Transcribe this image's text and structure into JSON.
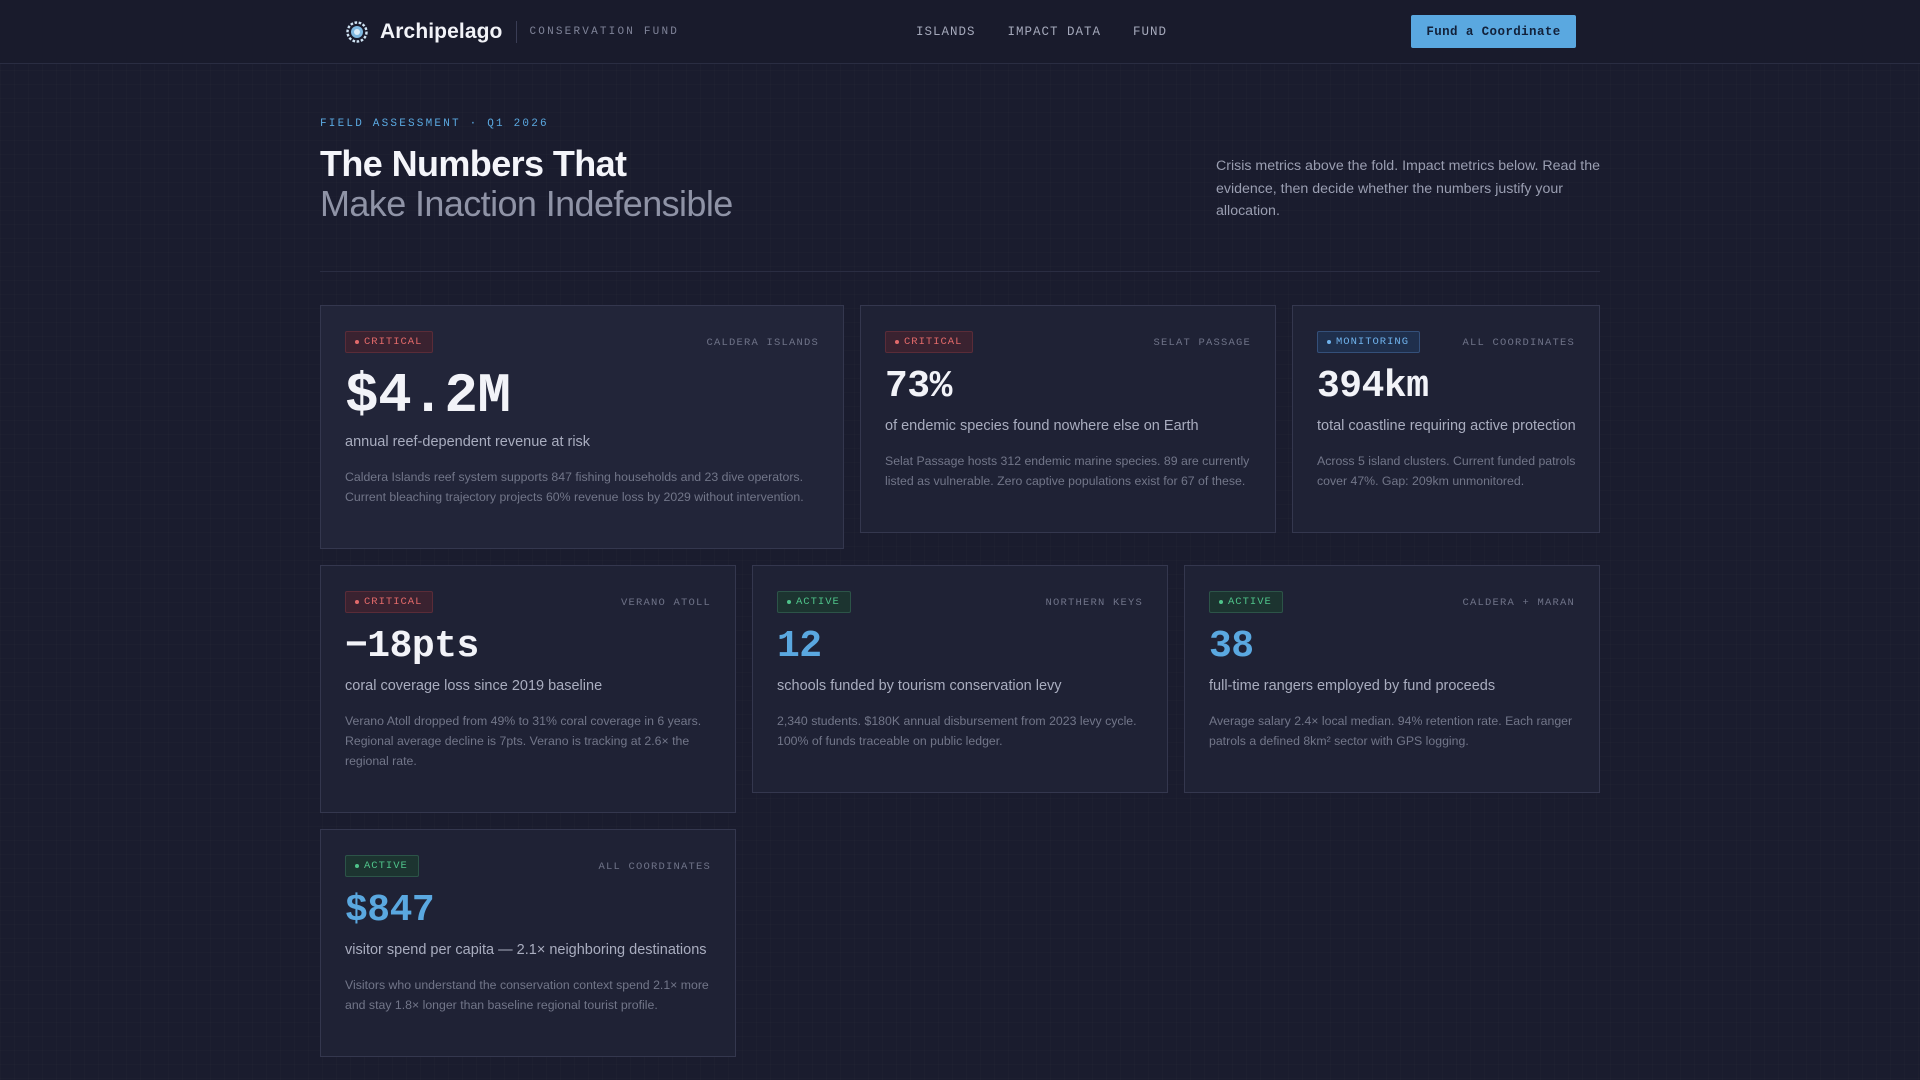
{
  "header": {
    "brand_name": "Archipelago",
    "brand_sub": "CONSERVATION FUND",
    "nav": [
      "ISLANDS",
      "IMPACT DATA",
      "FUND"
    ],
    "cta": "Fund a Coordinate"
  },
  "hero": {
    "eyebrow": "FIELD ASSESSMENT · Q1 2026",
    "title_line1": "The Numbers That",
    "title_line2": "Make Inaction Indefensible",
    "intro": "Crisis metrics above the fold. Impact metrics below. Read the evidence, then decide whether the numbers justify your allocation."
  },
  "cards": [
    {
      "status": "CRITICAL",
      "location": "CALDERA ISLANDS",
      "value": "$4.2M",
      "label": "annual reef-dependent revenue at risk",
      "description": "Caldera Islands reef system supports 847 fishing households and 23 dive operators. Current bleaching trajectory projects 60% revenue loss by 2029 without intervention."
    },
    {
      "status": "CRITICAL",
      "location": "SELAT PASSAGE",
      "value": "73%",
      "label": "of endemic species found nowhere else on Earth",
      "description": "Selat Passage hosts 312 endemic marine species. 89 are currently listed as vulnerable. Zero captive populations exist for 67 of these."
    },
    {
      "status": "MONITORING",
      "location": "ALL COORDINATES",
      "value": "394km",
      "label": "total coastline requiring active protection",
      "description": "Across 5 island clusters. Current funded patrols cover 47%. Gap: 209km unmonitored."
    },
    {
      "status": "CRITICAL",
      "location": "VERANO ATOLL",
      "value": "−18pts",
      "label": "coral coverage loss since 2019 baseline",
      "description": "Verano Atoll dropped from 49% to 31% coral coverage in 6 years. Regional average decline is 7pts. Verano is tracking at 2.6× the regional rate."
    },
    {
      "status": "ACTIVE",
      "location": "NORTHERN KEYS",
      "value": "12",
      "label": "schools funded by tourism conservation levy",
      "description": "2,340 students. $180K annual disbursement from 2023 levy cycle. 100% of funds traceable on public ledger."
    },
    {
      "status": "ACTIVE",
      "location": "CALDERA + MARAN",
      "value": "38",
      "label": "full-time rangers employed by fund proceeds",
      "description": "Average salary 2.4× local median. 94% retention rate. Each ranger patrols a defined 8km² sector with GPS logging."
    },
    {
      "status": "ACTIVE",
      "location": "ALL COORDINATES",
      "value": "$847",
      "label": "visitor spend per capita — 2.1× neighboring destinations",
      "description": "Visitors who understand the conservation context spend 2.1× more and stay 1.8× longer than baseline regional tourist profile."
    }
  ]
}
